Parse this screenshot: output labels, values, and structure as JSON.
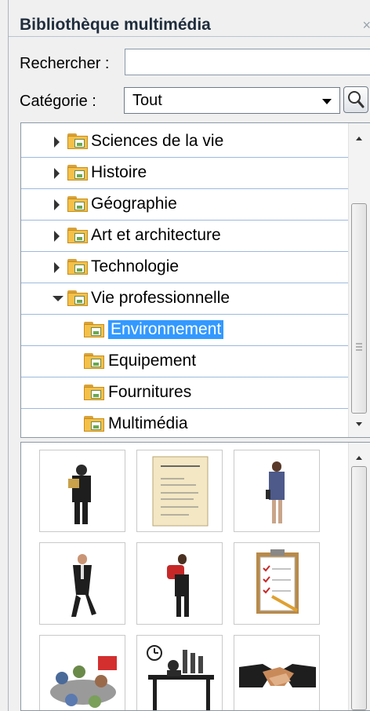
{
  "panel": {
    "title": "Bibliothèque multimédia",
    "close_glyph": "×"
  },
  "search": {
    "label": "Rechercher :",
    "value": "",
    "placeholder": ""
  },
  "category": {
    "label": "Catégorie :",
    "selected": "Tout",
    "search_button_icon": "magnifier-icon"
  },
  "tree": {
    "items": [
      {
        "label": "Sciences de la vie",
        "expander": "collapsed",
        "selected": false
      },
      {
        "label": "Histoire",
        "expander": "collapsed",
        "selected": false
      },
      {
        "label": "Géographie",
        "expander": "collapsed",
        "selected": false
      },
      {
        "label": "Art et architecture",
        "expander": "collapsed",
        "selected": false
      },
      {
        "label": "Technologie",
        "expander": "collapsed",
        "selected": false
      },
      {
        "label": "Vie professionnelle",
        "expander": "expanded",
        "selected": false
      },
      {
        "label": "Environnement",
        "expander": "none",
        "selected": true
      },
      {
        "label": "Equipement",
        "expander": "none",
        "selected": false
      },
      {
        "label": "Fournitures",
        "expander": "none",
        "selected": false
      },
      {
        "label": "Multimédia",
        "expander": "none",
        "selected": false
      }
    ]
  },
  "gallery": {
    "thumbnails": [
      {
        "name": "woman-holding-folder-icon"
      },
      {
        "name": "invoice-document-icon"
      },
      {
        "name": "businesswoman-walking-icon"
      },
      {
        "name": "businessman-walking-icon"
      },
      {
        "name": "woman-carrying-box-icon"
      },
      {
        "name": "clipboard-checklist-icon"
      },
      {
        "name": "meeting-table-icon"
      },
      {
        "name": "worker-at-desk-clock-icon"
      },
      {
        "name": "handshake-icon"
      }
    ]
  },
  "colors": {
    "selection": "#3399ff",
    "row_separator": "#9db9dd",
    "folder": "#f4c04a"
  }
}
